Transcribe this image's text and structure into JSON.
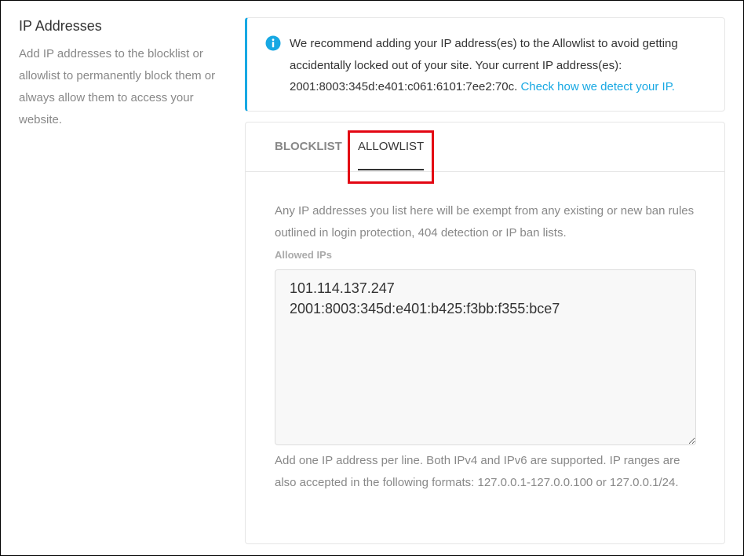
{
  "section": {
    "title": "IP Addresses",
    "description": "Add IP addresses to the blocklist or allowlist to permanently block them or always allow them to access your website."
  },
  "notice": {
    "icon": "info-icon",
    "text": "We recommend adding your IP address(es) to the Allowlist to avoid getting accidentally locked out of your site. Your current IP address(es): 2001:8003:345d:e401:c061:6101:7ee2:70c.",
    "link_label": "Check how we detect your IP.",
    "accent_color": "#17a8e3"
  },
  "tabs": [
    {
      "label": "BLOCKLIST",
      "active": false
    },
    {
      "label": "ALLOWLIST",
      "active": true
    }
  ],
  "allowlist": {
    "help": "Any IP addresses you list here will be exempt from any existing or new ban rules outlined in login protection, 404 detection or IP ban lists.",
    "field_label": "Allowed IPs",
    "value": "101.114.137.247\n2001:8003:345d:e401:b425:f3bb:f355:bce7",
    "field_help": "Add one IP address per line. Both IPv4 and IPv6 are supported. IP ranges are also accepted in the following formats: 127.0.0.1-127.0.0.100 or 127.0.0.1/24."
  },
  "highlight_color": "#e30613"
}
